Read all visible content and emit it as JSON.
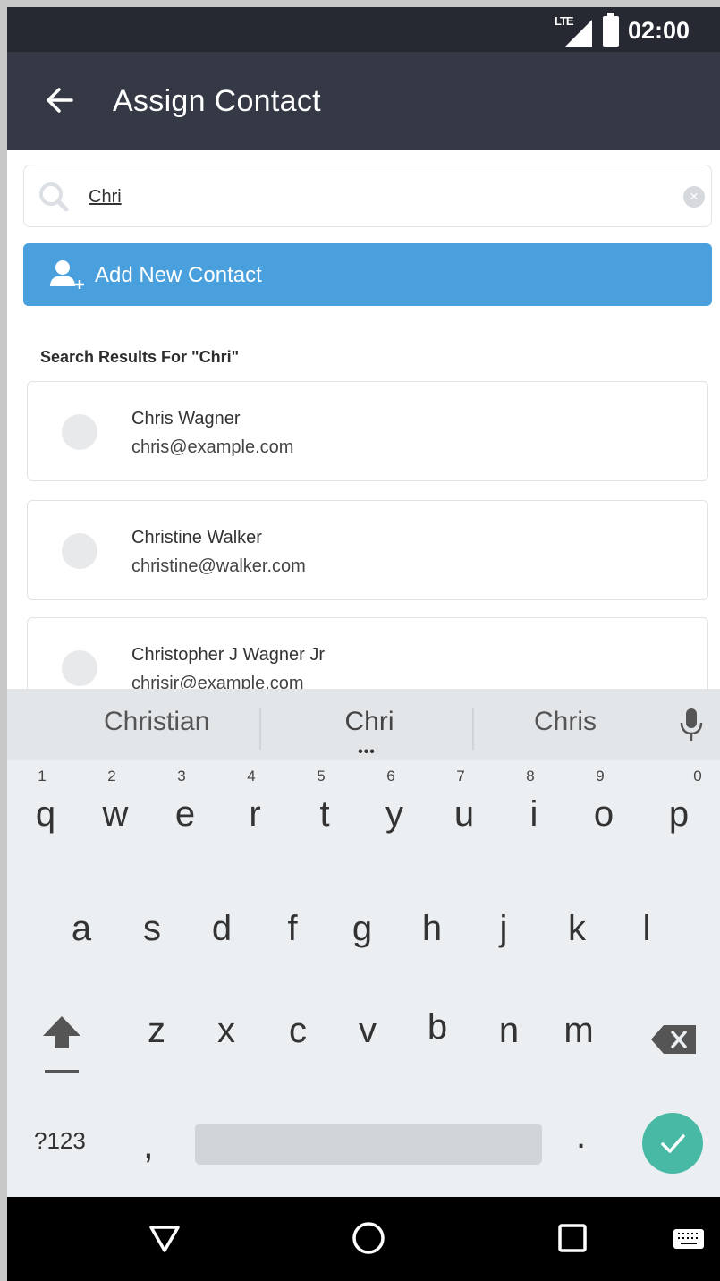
{
  "status_bar": {
    "network": "LTE",
    "time": "02:00"
  },
  "app_bar": {
    "back_icon": "arrow-back-icon",
    "title": "Assign Contact"
  },
  "search": {
    "icon": "search-icon",
    "value": "Chri",
    "placeholder": "",
    "clear_icon": "clear-icon"
  },
  "add_contact": {
    "icon": "add-person-icon",
    "label": "Add New Contact",
    "color": "#4aa0dc"
  },
  "results": {
    "heading": "Search Results For \"Chri\"",
    "items": [
      {
        "name": "Chris Wagner",
        "email": "chris@example.com"
      },
      {
        "name": "Christine Walker",
        "email": "christine@walker.com"
      },
      {
        "name": "Christopher J Wagner Jr",
        "email": "chrisjr@example.com"
      }
    ]
  },
  "keyboard": {
    "suggestions": [
      "Christian",
      "Chri",
      "Chris"
    ],
    "suggestion_more": "•••",
    "mic_icon": "microphone-icon",
    "row1": [
      {
        "ch": "q",
        "num": "1"
      },
      {
        "ch": "w",
        "num": "2"
      },
      {
        "ch": "e",
        "num": "3"
      },
      {
        "ch": "r",
        "num": "4"
      },
      {
        "ch": "t",
        "num": "5"
      },
      {
        "ch": "y",
        "num": "6"
      },
      {
        "ch": "u",
        "num": "7"
      },
      {
        "ch": "i",
        "num": "8"
      },
      {
        "ch": "o",
        "num": "9"
      },
      {
        "ch": "p",
        "num": "0"
      }
    ],
    "row2": [
      "a",
      "s",
      "d",
      "f",
      "g",
      "h",
      "j",
      "k",
      "l"
    ],
    "row3": [
      "z",
      "x",
      "c",
      "v",
      "b",
      "n",
      "m"
    ],
    "symbols_label": "?123",
    "comma": ",",
    "period": ".",
    "accent_color": "#47b9a4"
  },
  "nav_bar": {
    "back_icon": "nav-back-icon",
    "home_icon": "nav-home-icon",
    "recents_icon": "nav-recents-icon",
    "keyboard_icon": "keyboard-icon"
  }
}
